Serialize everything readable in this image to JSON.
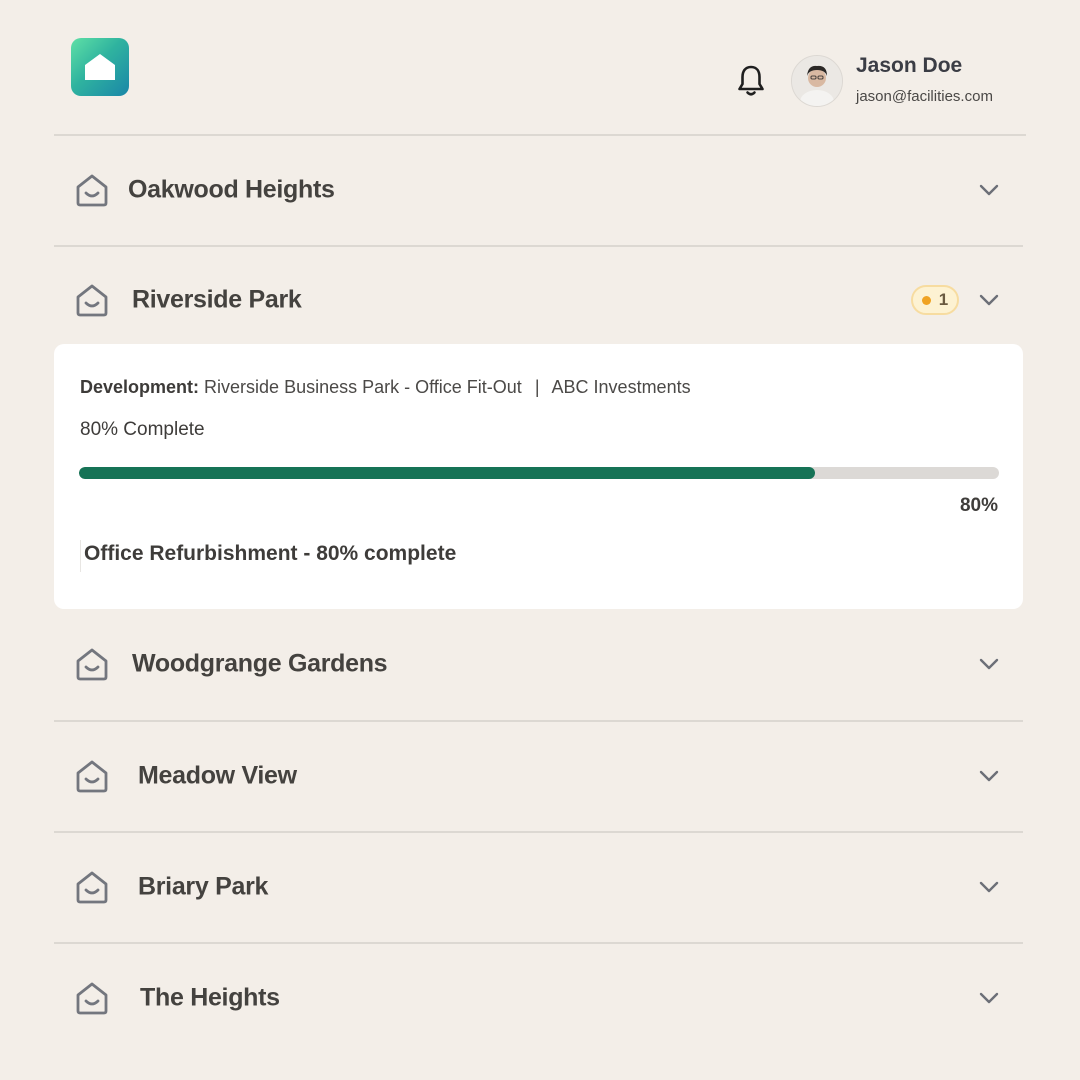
{
  "header": {
    "logo_icon": "home-icon",
    "notification_icon": "bell-icon",
    "user": {
      "name": "Jason Doe",
      "email": "jason@facilities.com"
    }
  },
  "properties": [
    {
      "name": "Oakwood Heights",
      "icon": "house-icon",
      "expanded": false
    },
    {
      "name": "Riverside Park",
      "icon": "house-icon",
      "expanded": true,
      "badge_count": "1"
    },
    {
      "name": "Woodgrange Gardens",
      "icon": "house-icon",
      "expanded": false
    },
    {
      "name": "Meadow View",
      "icon": "house-icon",
      "expanded": false
    },
    {
      "name": "Briary Park",
      "icon": "house-icon",
      "expanded": false
    },
    {
      "name": "The Heights",
      "icon": "house-icon",
      "expanded": false
    }
  ],
  "expanded_detail": {
    "development_label": "Development:",
    "development_name": "Riverside Business Park - Office Fit-Out",
    "separator": "|",
    "investor": "ABC Investments",
    "complete_text": "80% Complete",
    "progress_percent": 80,
    "progress_label": "80%",
    "task": "Office Refurbishment - 80% complete"
  },
  "colors": {
    "background": "#f3eee8",
    "progress_fill": "#167356",
    "progress_track": "#dcd9d6",
    "badge_dot": "#f0a322",
    "badge_bg": "#fdf2d2"
  }
}
